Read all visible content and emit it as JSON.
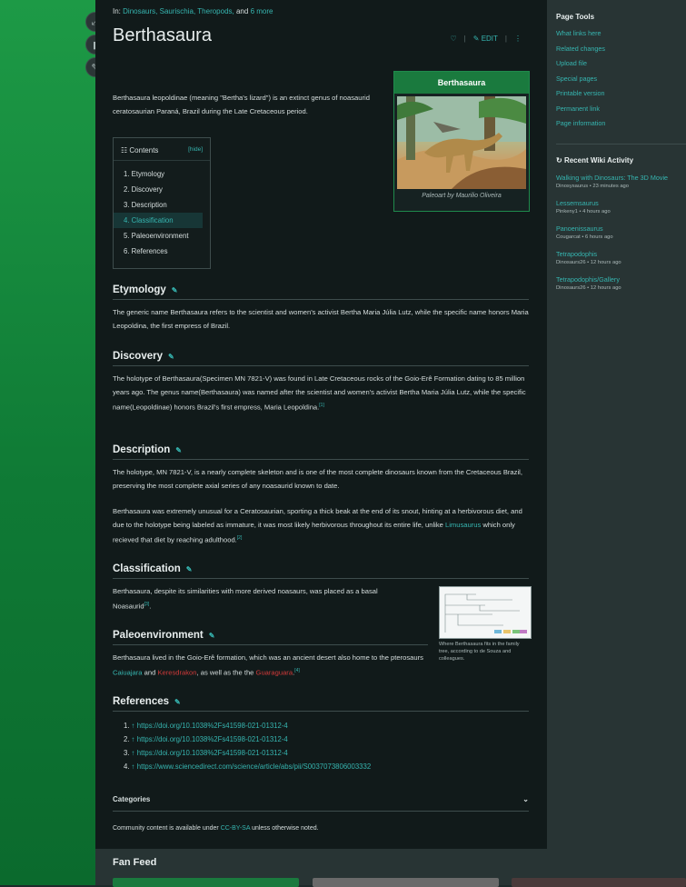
{
  "breadcrumb": {
    "prefix": "In:",
    "items": [
      "Dinosaurs,",
      "Saurischia,",
      "Theropods,"
    ],
    "and": "and",
    "more": "6 more"
  },
  "page_title": "Berthasaura",
  "title_tools": {
    "comment_icon": "♡",
    "edit_label": "EDIT",
    "more": "⋮"
  },
  "intro": "Berthasaura leopoldinae (meaning \"Bertha's lizard\") is an extinct genus of noasaurid ceratosaurian Paraná, Brazil during the Late Cretaceous period.",
  "infobox": {
    "title": "Berthasaura",
    "caption": "Paleoart by Maurilio Oliveira"
  },
  "toc": {
    "title": "Contents",
    "hide": "hide",
    "items": [
      "1. Etymology",
      "2. Discovery",
      "3. Description",
      "4. Classification",
      "5. Paleoenvironment",
      "6. References"
    ]
  },
  "sections": {
    "etymology": {
      "title": "Etymology",
      "text": "The generic name Berthasaura refers to the scientist and women's activist Bertha Maria Júlia Lutz, while the specific name honors Maria Leopoldina, the first empress of Brazil."
    },
    "discovery": {
      "title": "Discovery",
      "text": "The holotype of Berthasaura(Specimen MN 7821-V) was found in Late Cretaceous rocks of the Goio-Erê Formation dating to 85 million years ago. The genus name(Berthasaura) was named after the scientist and women's activist Bertha Maria Júlia Lutz, while the specific name(Leopoldinae) honors Brazil's first empress, Maria Leopoldina.",
      "sup": "[1]"
    },
    "description": {
      "title": "Description",
      "p1": "The holotype, MN 7821-V, is a nearly complete skeleton and is one of the most complete dinosaurs known from the Cretaceous Brazil, preserving the most complete axial series of any noasaurid known to date.",
      "p2_a": "Berthasaura was extremely unusual for a Ceratosaurian, sporting a thick beak at the end of its snout, hinting at a herbivorous diet, and due to the holotype being labeled as immature, it was most likely herbivorous throughout its entire life, unlike",
      "p2_link": "Limusaurus",
      "p2_b": "which only recieved that diet by reaching adulthood.",
      "sup": "[2]"
    },
    "classification": {
      "title": "Classification",
      "text": "Berthasaura, despite its similarities with more derived noasaurs, was placed as a basal Noasaurid",
      "sup": "[3]",
      "image_caption": "Where Berthasaura fits in the family tree, according to de Souza and colleagues."
    },
    "paleoenvironment": {
      "title": "Paleoenvironment",
      "text_a": "Berthasaura lived in the Goio-Erê formation, which was an ancient desert also home to the pterosaurs",
      "link1": "Caiuajara",
      "and": "and",
      "link2": "Keresdrakon",
      "text_b": ", as well as the the",
      "link3": "Guaraguara",
      "sup": "[4]"
    },
    "references": {
      "title": "References",
      "items": [
        "↑ https://doi.org/10.1038%2Fs41598-021-01312-4",
        "↑ https://doi.org/10.1038%2Fs41598-021-01312-4",
        "↑ https://doi.org/10.1038%2Fs41598-021-01312-4",
        "↑ https://www.sciencedirect.com/science/article/abs/pii/S0037073806003332"
      ]
    }
  },
  "categories_label": "Categories",
  "license": {
    "prefix": "Community content is available under",
    "link": "CC-BY-SA",
    "suffix": "unless otherwise noted."
  },
  "right_rail": {
    "page_tools_title": "Page Tools",
    "page_tools": [
      "What links here",
      "Related changes",
      "Upload file",
      "Special pages",
      "Printable version",
      "Permanent link",
      "Page information"
    ],
    "activity_title": "Recent Wiki Activity",
    "activity": [
      {
        "title": "Walking with Dinosaurs: The 3D Movie",
        "meta": "Dinosysaurus • 23 minutes ago"
      },
      {
        "title": "Lessemsaurus",
        "meta": "Pinkeny1 • 4 hours ago"
      },
      {
        "title": "Panoenissaurus",
        "meta": "Cougarcat • 6 hours ago"
      },
      {
        "title": "Tetrapodophis",
        "meta": "Dinosaurs26 • 12 hours ago"
      },
      {
        "title": "Tetrapodophis/Gallery",
        "meta": "Dinosaurs26 • 12 hours ago"
      }
    ]
  },
  "fan_feed_title": "Fan Feed",
  "colors": {
    "accent": "#36b5b0",
    "brand_green": "#1a7a3e",
    "red_link": "#d33a3a"
  }
}
